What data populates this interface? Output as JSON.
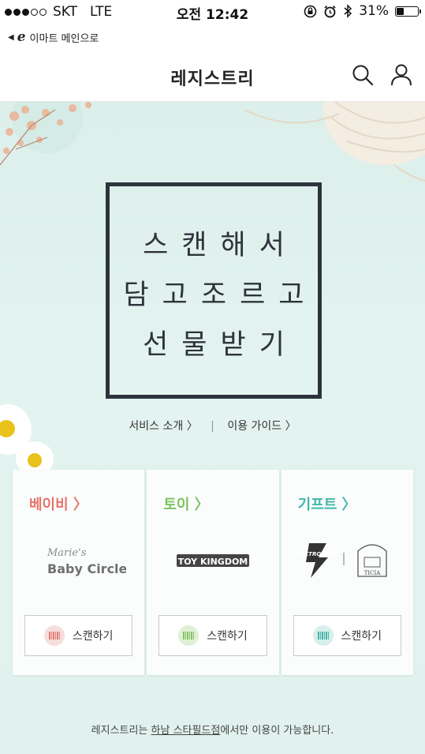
{
  "status_bar": {
    "carrier": "SKT",
    "network": "LTE",
    "time": "오전 12:42",
    "battery": "31%",
    "battery_level": 0.31
  },
  "back_link": {
    "logo": "e",
    "label": "이마트 메인으로"
  },
  "header": {
    "title": "레지스트리",
    "search_icon": "search-icon",
    "user_icon": "user-icon"
  },
  "hero": {
    "lines": [
      "스캔해서",
      "담고조르고",
      "선물받기"
    ],
    "links": {
      "service_intro": "서비스 소개",
      "usage_guide": "이용 가이드"
    }
  },
  "cards": [
    {
      "title": "베이비",
      "color": "#e8736a",
      "brands": [
        "Marie's",
        "Baby Circle"
      ],
      "scan_label": "스캔하기",
      "scan_color": "#f6dedd",
      "bar_color": "#e07a72"
    },
    {
      "title": "토이",
      "color": "#7dc25d",
      "brands": [
        "TOY KINGDOM"
      ],
      "scan_label": "스캔하기",
      "scan_color": "#e0f0d6",
      "bar_color": "#86c267"
    },
    {
      "title": "기프트",
      "color": "#3fb8a8",
      "brands": [
        "ELECTRO MART",
        "TICIA"
      ],
      "scan_label": "스캔하기",
      "scan_color": "#d7efec",
      "bar_color": "#45b3a4"
    }
  ],
  "footer": {
    "prefix": "레지스트리는 ",
    "store": "하남 스타필드점",
    "suffix": "에서만 이용이 가능합니다."
  }
}
